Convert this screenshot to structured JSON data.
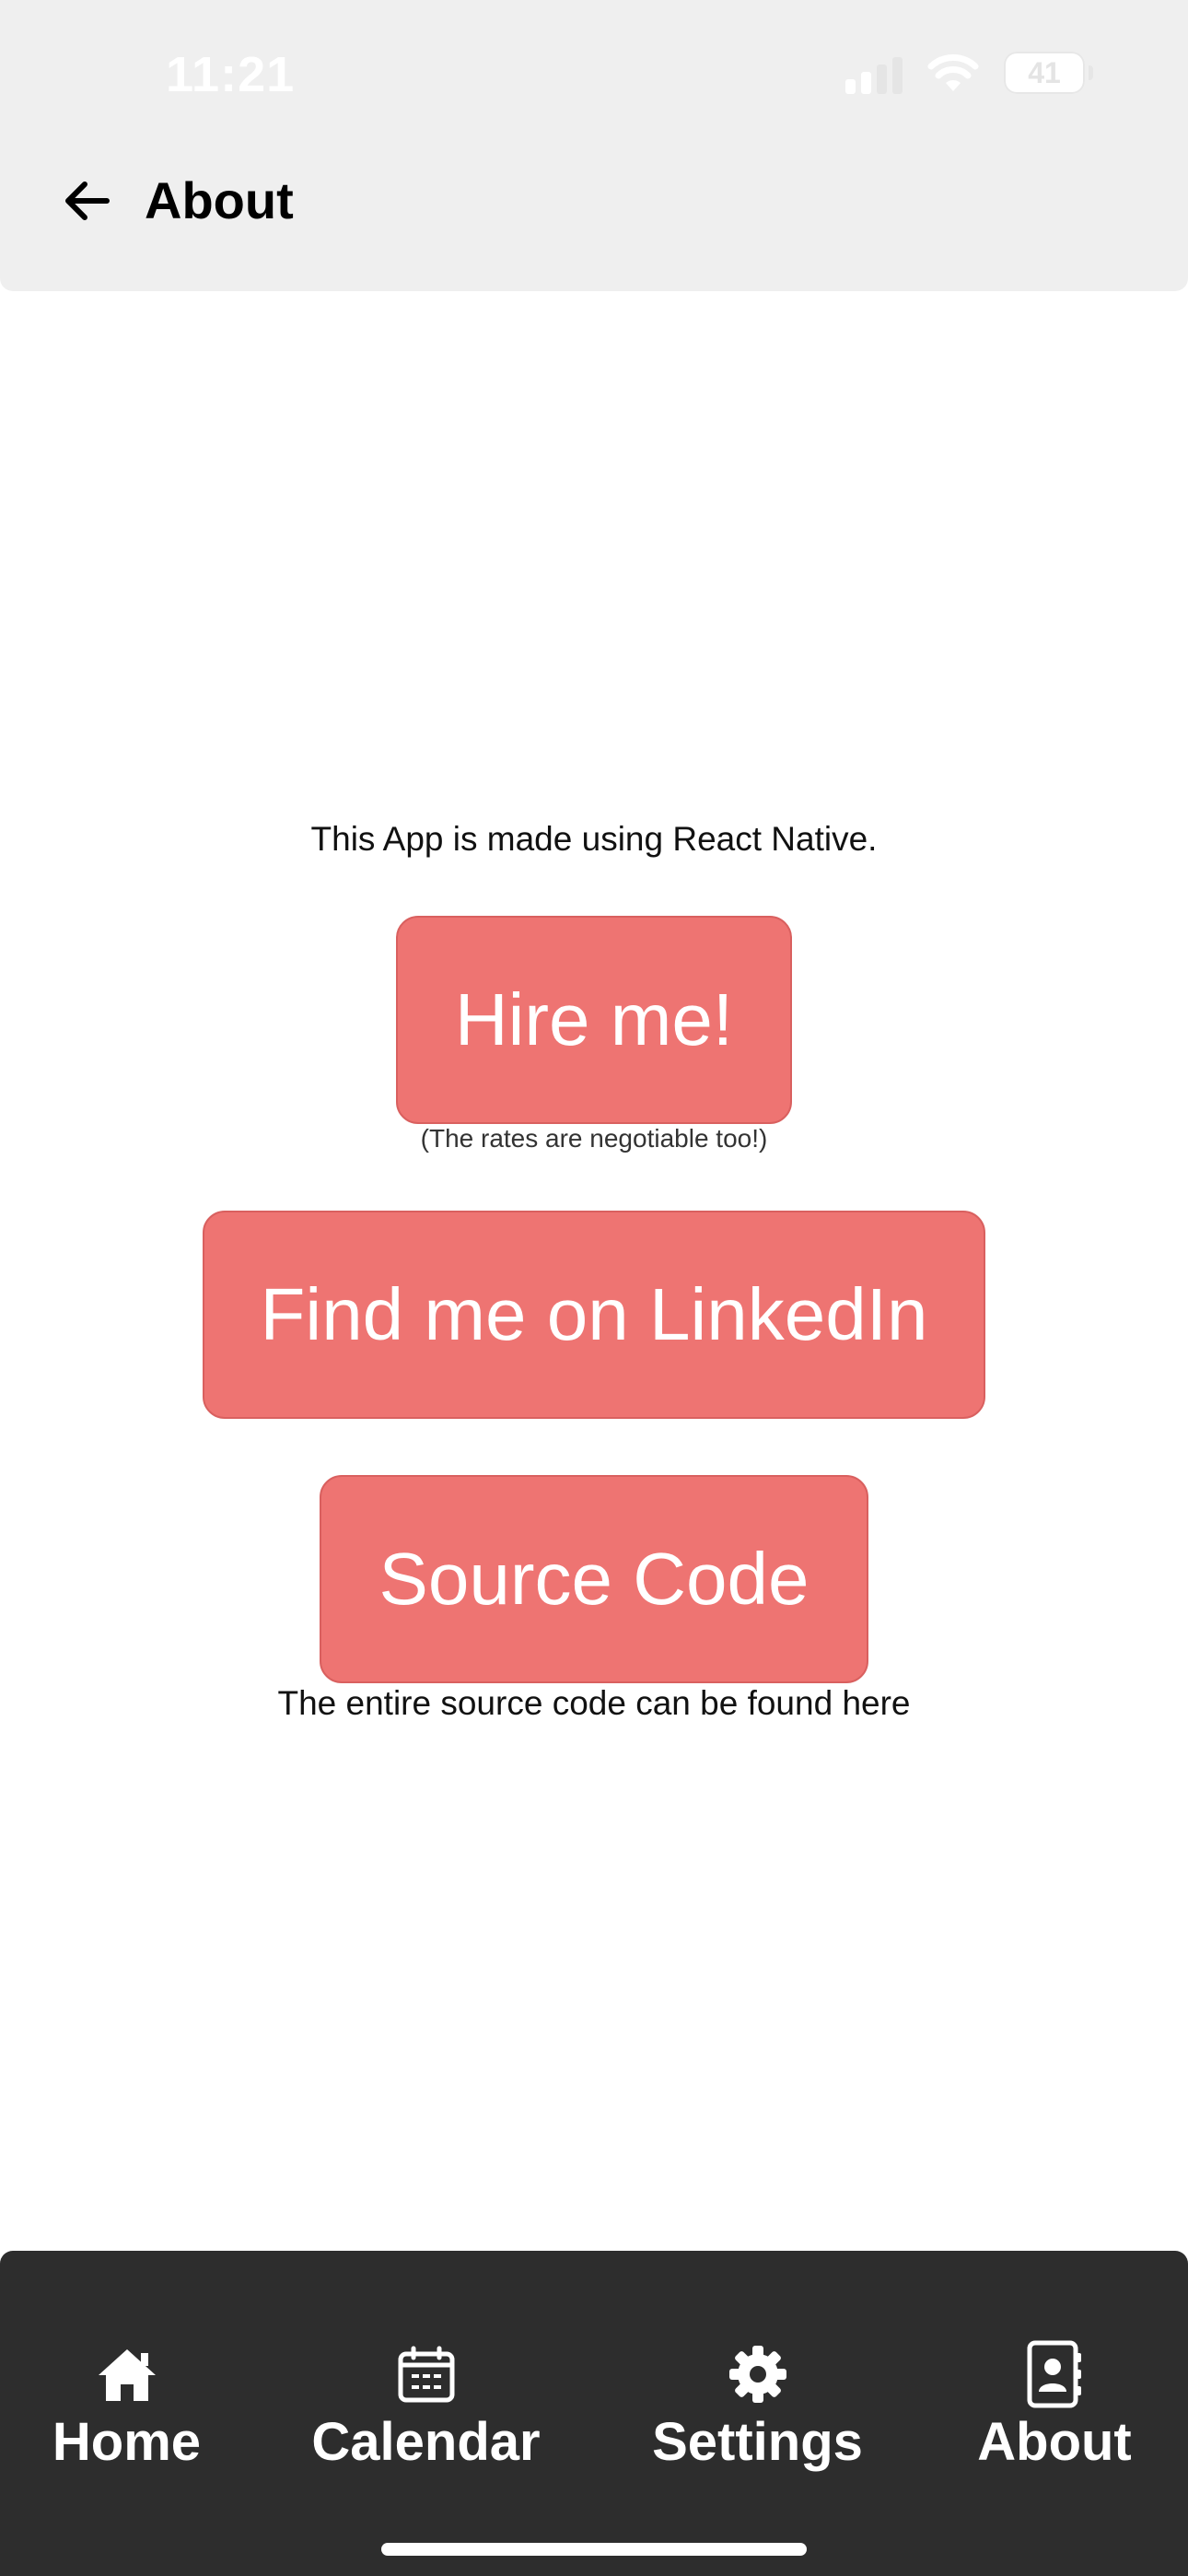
{
  "status_bar": {
    "time": "11:21",
    "battery_level": "41"
  },
  "header": {
    "back_icon": "arrow-left-icon",
    "title": "About"
  },
  "content": {
    "intro": "This App is made using React Native.",
    "hire_button": "Hire me!",
    "hire_note": "(The rates are negotiable too!)",
    "linkedin_button": "Find me on LinkedIn",
    "source_button": "Source Code",
    "source_note": "The entire source code can be found here"
  },
  "tabs": [
    {
      "label": "Home",
      "icon": "home-icon"
    },
    {
      "label": "Calendar",
      "icon": "calendar-icon"
    },
    {
      "label": "Settings",
      "icon": "gear-icon"
    },
    {
      "label": "About",
      "icon": "contact-book-icon"
    }
  ],
  "colors": {
    "button": "#ee7472",
    "header_bg": "#efefef",
    "tabbar_bg": "#2d2d2d"
  }
}
